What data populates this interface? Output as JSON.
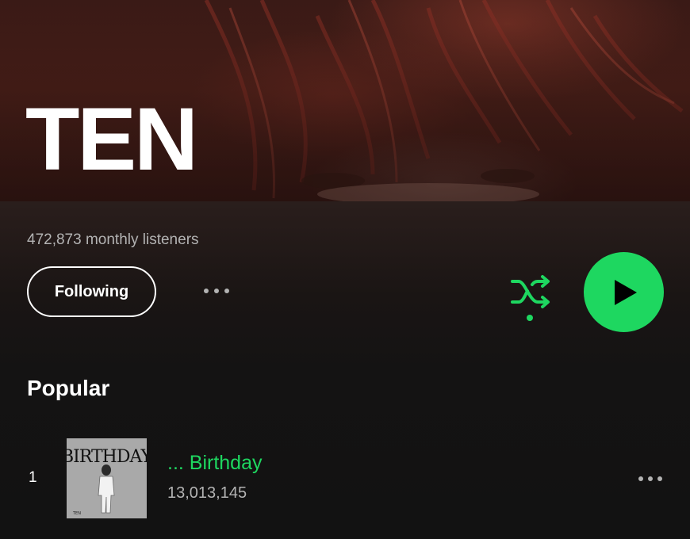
{
  "artist": {
    "name": "TEN",
    "monthly_listeners": "472,873 monthly listeners"
  },
  "actions": {
    "follow_label": "Following",
    "more_icon": "more-horizontal-icon",
    "shuffle_icon": "shuffle-icon",
    "play_icon": "play-icon"
  },
  "colors": {
    "accent": "#1ed760",
    "background": "#121212",
    "secondary_text": "#b3b3b3"
  },
  "popular": {
    "title": "Popular",
    "tracks": [
      {
        "rank": "1",
        "title": "... Birthday",
        "plays": "13,013,145",
        "cover_title": "BIRTHDAY",
        "cover_artist": "TEN"
      }
    ]
  }
}
